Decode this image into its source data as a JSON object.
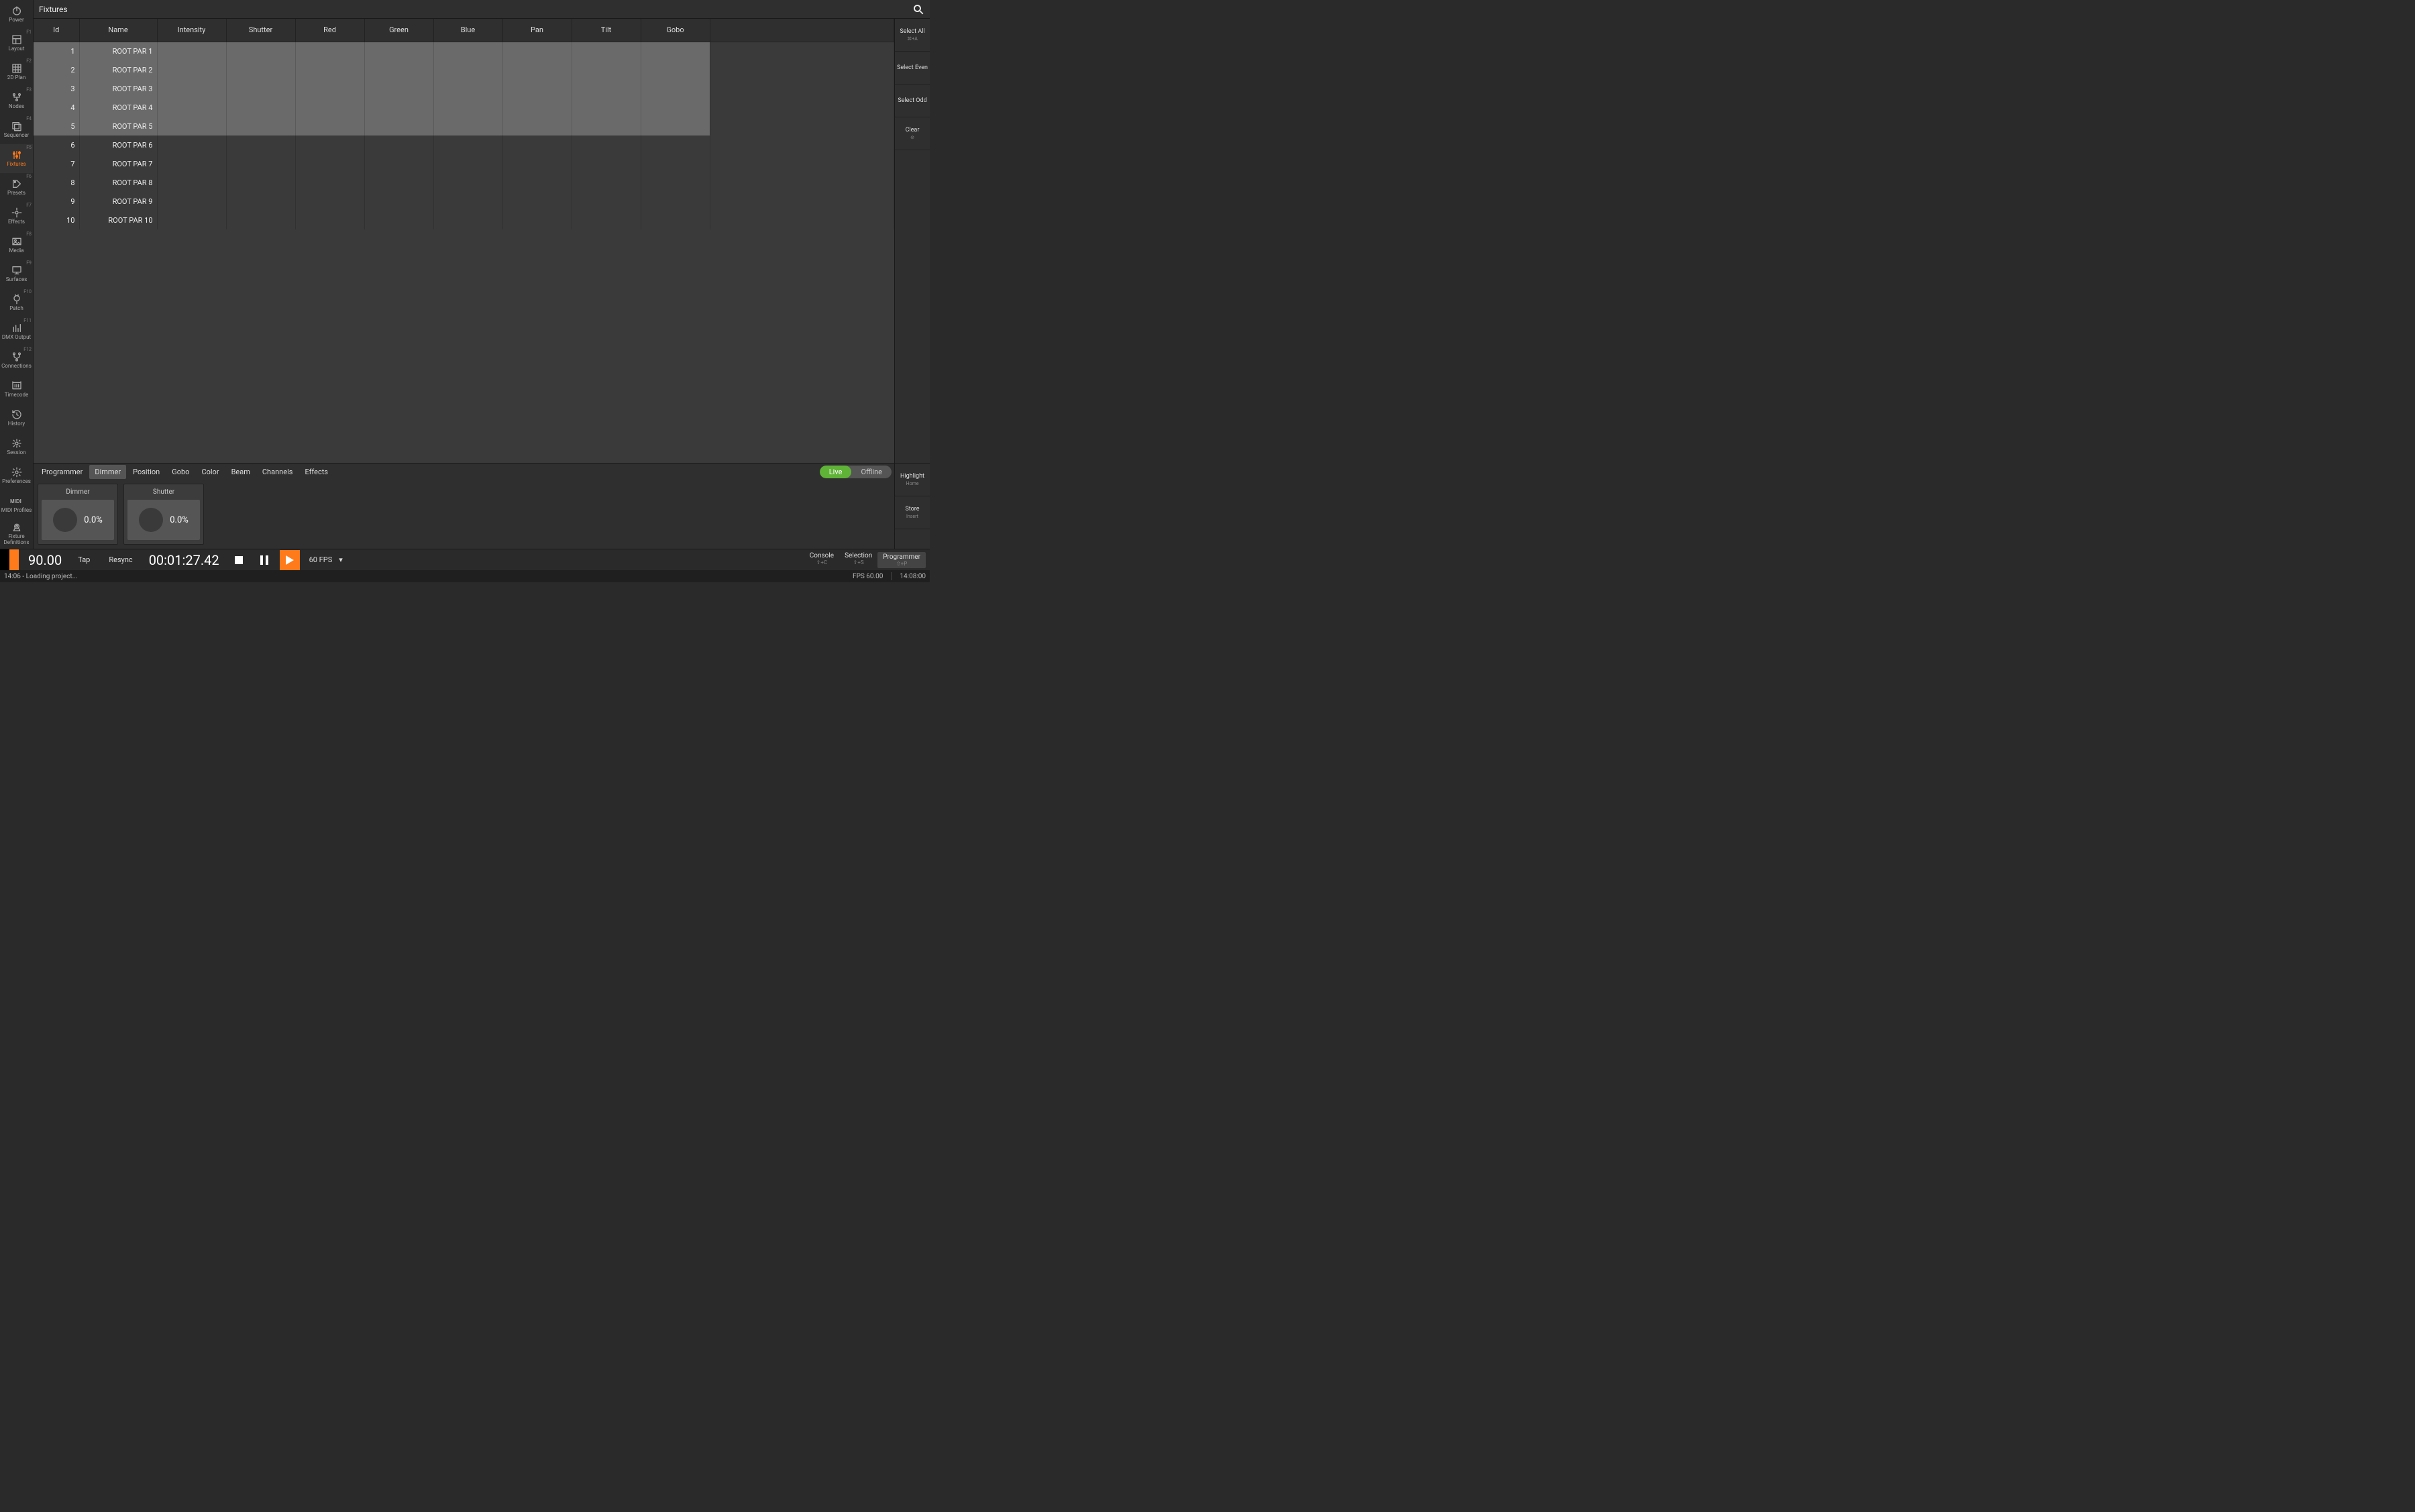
{
  "app": {
    "title": "Fixtures"
  },
  "sidebar": [
    {
      "label": "Power",
      "fkey": "",
      "icon": "power"
    },
    {
      "label": "Layout",
      "fkey": "F1",
      "icon": "layout"
    },
    {
      "label": "2D Plan",
      "fkey": "F2",
      "icon": "grid"
    },
    {
      "label": "Nodes",
      "fkey": "F3",
      "icon": "nodes"
    },
    {
      "label": "Sequencer",
      "fkey": "F4",
      "icon": "sequencer"
    },
    {
      "label": "Fixtures",
      "fkey": "F5",
      "icon": "sliders",
      "active": true
    },
    {
      "label": "Presets",
      "fkey": "F6",
      "icon": "swatch"
    },
    {
      "label": "Effects",
      "fkey": "F7",
      "icon": "sparkle"
    },
    {
      "label": "Media",
      "fkey": "F8",
      "icon": "image"
    },
    {
      "label": "Surfaces",
      "fkey": "F9",
      "icon": "monitor"
    },
    {
      "label": "Patch",
      "fkey": "F10",
      "icon": "plug"
    },
    {
      "label": "DMX Output",
      "fkey": "F11",
      "icon": "bars"
    },
    {
      "label": "Connections",
      "fkey": "F12",
      "icon": "fork"
    },
    {
      "label": "Timecode",
      "fkey": "",
      "icon": "timecode"
    },
    {
      "label": "History",
      "fkey": "",
      "icon": "history"
    },
    {
      "label": "Session",
      "fkey": "",
      "icon": "session"
    },
    {
      "label": "Preferences",
      "fkey": "",
      "icon": "gear"
    },
    {
      "label": "MIDI Profiles",
      "fkey": "",
      "icon": "midi"
    },
    {
      "label": "Fixture Definitions",
      "fkey": "",
      "icon": "fixturedef"
    }
  ],
  "right_rail": [
    {
      "label": "Select All",
      "sub": "⌘+A"
    },
    {
      "label": "Select Even",
      "sub": ""
    },
    {
      "label": "Select Odd",
      "sub": ""
    },
    {
      "label": "Clear",
      "sub": "⊘"
    }
  ],
  "table": {
    "columns": [
      "Id",
      "Name",
      "Intensity",
      "Shutter",
      "Red",
      "Green",
      "Blue",
      "Pan",
      "Tilt",
      "Gobo"
    ],
    "rows": [
      {
        "id": "1",
        "name": "ROOT PAR 1",
        "selected": true
      },
      {
        "id": "2",
        "name": "ROOT PAR 2",
        "selected": true
      },
      {
        "id": "3",
        "name": "ROOT PAR 3",
        "selected": true
      },
      {
        "id": "4",
        "name": "ROOT PAR 4",
        "selected": true
      },
      {
        "id": "5",
        "name": "ROOT PAR 5",
        "selected": true
      },
      {
        "id": "6",
        "name": "ROOT PAR 6",
        "selected": false
      },
      {
        "id": "7",
        "name": "ROOT PAR 7",
        "selected": false
      },
      {
        "id": "8",
        "name": "ROOT PAR 8",
        "selected": false
      },
      {
        "id": "9",
        "name": "ROOT PAR 9",
        "selected": false
      },
      {
        "id": "10",
        "name": "ROOT PAR 10",
        "selected": false
      }
    ]
  },
  "programmer": {
    "tabs": [
      "Programmer",
      "Dimmer",
      "Position",
      "Gobo",
      "Color",
      "Beam",
      "Channels",
      "Effects"
    ],
    "active_tab": "Dimmer",
    "live_label": "Live",
    "offline_label": "Offline",
    "encoders": [
      {
        "title": "Dimmer",
        "value": "0.0%"
      },
      {
        "title": "Shutter",
        "value": "0.0%"
      }
    ],
    "side": [
      {
        "label": "Highlight",
        "sub": "Home"
      },
      {
        "label": "Store",
        "sub": "Insert"
      }
    ]
  },
  "transport": {
    "bpm": "90.00",
    "tap": "Tap",
    "resync": "Resync",
    "timecode": "00:01:27.42",
    "fps": "60 FPS",
    "right": [
      {
        "label": "Console",
        "sub": "⇧+C"
      },
      {
        "label": "Selection",
        "sub": "⇧+S"
      },
      {
        "label": "Programmer",
        "sub": "⇧+P",
        "active": true
      }
    ]
  },
  "status": {
    "left": "14:06 - Loading project...",
    "fps": "FPS 60.00",
    "clock": "14:08:00"
  }
}
